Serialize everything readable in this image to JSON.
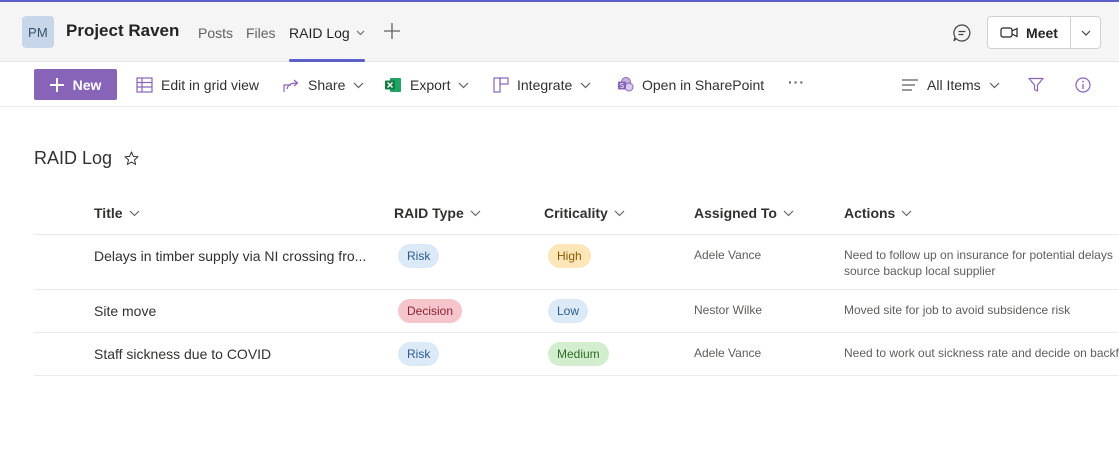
{
  "header": {
    "avatar_initials": "PM",
    "team_name": "Project Raven",
    "tabs": [
      {
        "label": "Posts",
        "active": false
      },
      {
        "label": "Files",
        "active": false
      },
      {
        "label": "RAID Log",
        "active": true
      }
    ],
    "meet_label": "Meet",
    "accent_color": "#5b5fc7"
  },
  "commandbar": {
    "new_label": "New",
    "edit_grid_label": "Edit in grid view",
    "share_label": "Share",
    "export_label": "Export",
    "integrate_label": "Integrate",
    "sharepoint_label": "Open in SharePoint",
    "more_label": "···",
    "view_label": "All Items",
    "new_color": "#8764b8"
  },
  "list": {
    "title": "RAID Log",
    "columns": [
      "Title",
      "RAID Type",
      "Criticality",
      "Assigned To",
      "Actions"
    ],
    "rows": [
      {
        "title": "Delays in timber supply via NI crossing fro...",
        "raid_type": "Risk",
        "criticality": "High",
        "assigned_to": "Adele Vance",
        "actions_line1": "Need to follow up on insurance for potential delays",
        "actions_line2": "source backup local supplier"
      },
      {
        "title": "Site move",
        "raid_type": "Decision",
        "criticality": "Low",
        "assigned_to": "Nestor Wilke",
        "actions_line1": "Moved site for job to avoid subsidence risk",
        "actions_line2": ""
      },
      {
        "title": "Staff sickness due to COVID",
        "raid_type": "Risk",
        "criticality": "Medium",
        "assigned_to": "Adele Vance",
        "actions_line1": "Need to work out sickness rate and decide on backfi",
        "actions_line2": ""
      }
    ],
    "pill_colors": {
      "Risk": {
        "bg": "#dce9f7",
        "fg": "#2b5c8f"
      },
      "Decision": {
        "bg": "#f6c4cb",
        "fg": "#8a2433"
      },
      "High": {
        "bg": "#fde7b8",
        "fg": "#8a5a00"
      },
      "Low": {
        "bg": "#dce9f7",
        "fg": "#2b5c8f"
      },
      "Medium": {
        "bg": "#d3eecf",
        "fg": "#2f6b26"
      }
    }
  }
}
